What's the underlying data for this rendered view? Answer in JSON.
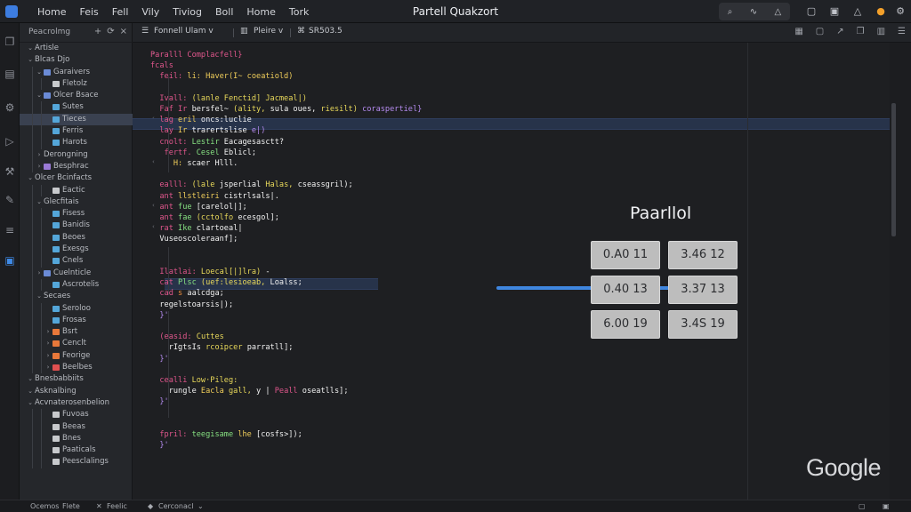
{
  "window": {
    "title": "Partell Quakzort",
    "menu": [
      "Home",
      "Feis",
      "Fell",
      "Vily",
      "Tiviog",
      "Boll",
      "Home",
      "Tork"
    ],
    "controls": [
      "search-icon",
      "pulse-icon",
      "bell-icon"
    ]
  },
  "sidebar": {
    "title": "Peacrolmg",
    "actions": [
      "+",
      "⟳",
      "×"
    ],
    "items": [
      {
        "label": "Artisle",
        "depth": 0,
        "chev": "v",
        "color": ""
      },
      {
        "label": "Blcas Djo",
        "depth": 0,
        "chev": "v",
        "color": ""
      },
      {
        "label": "Garaivers",
        "depth": 1,
        "chev": "v",
        "color": "#6b8bd6"
      },
      {
        "label": "Fletolz",
        "depth": 2,
        "chev": "",
        "color": "#c7c9cc"
      },
      {
        "label": "Olcer Bsace",
        "depth": 1,
        "chev": "v",
        "color": "#6b8bd6"
      },
      {
        "label": "Sutes",
        "depth": 2,
        "chev": "",
        "color": "#54a6d9"
      },
      {
        "label": "Tieces",
        "depth": 2,
        "chev": "",
        "color": "#54a6d9"
      },
      {
        "label": "Ferris",
        "depth": 2,
        "chev": "",
        "color": "#54a6d9"
      },
      {
        "label": "Harots",
        "depth": 2,
        "chev": "",
        "color": "#54a6d9"
      },
      {
        "label": "Derongning",
        "depth": 1,
        "chev": ">",
        "color": ""
      },
      {
        "label": "Besphrac",
        "depth": 1,
        "chev": ">",
        "color": "#9a7ad6"
      },
      {
        "label": "Olcer Bcinfacts",
        "depth": 0,
        "chev": "v",
        "color": ""
      },
      {
        "label": "Eactic",
        "depth": 2,
        "chev": "",
        "color": "#c7c9cc"
      },
      {
        "label": "Glecfitais",
        "depth": 1,
        "chev": "v",
        "color": ""
      },
      {
        "label": "Fisess",
        "depth": 2,
        "chev": "",
        "color": "#54a6d9"
      },
      {
        "label": "Banidis",
        "depth": 2,
        "chev": "",
        "color": "#54a6d9"
      },
      {
        "label": "Beoes",
        "depth": 2,
        "chev": "",
        "color": "#54a6d9"
      },
      {
        "label": "Exesgs",
        "depth": 2,
        "chev": "",
        "color": "#54a6d9"
      },
      {
        "label": "Cnels",
        "depth": 2,
        "chev": "",
        "color": "#54a6d9"
      },
      {
        "label": "Cuelnticle",
        "depth": 1,
        "chev": ">",
        "color": "#6b8bd6"
      },
      {
        "label": "Ascrotelis",
        "depth": 2,
        "chev": "",
        "color": "#54a6d9"
      },
      {
        "label": "Secaes",
        "depth": 1,
        "chev": "v",
        "color": ""
      },
      {
        "label": "Seroloo",
        "depth": 2,
        "chev": "",
        "color": "#54a6d9"
      },
      {
        "label": "Frosas",
        "depth": 2,
        "chev": "",
        "color": "#54a6d9"
      },
      {
        "label": "Bsrt",
        "depth": 2,
        "chev": ">",
        "color": "#e8783a"
      },
      {
        "label": "Cenclt",
        "depth": 2,
        "chev": ">",
        "color": "#e8783a"
      },
      {
        "label": "Feorige",
        "depth": 2,
        "chev": ">",
        "color": "#e8783a"
      },
      {
        "label": "Beelbes",
        "depth": 2,
        "chev": ">",
        "color": "#e05050"
      },
      {
        "label": "Bnesbabbiits",
        "depth": 0,
        "chev": "v",
        "color": ""
      },
      {
        "label": "Asknalbing",
        "depth": 0,
        "chev": "v",
        "color": ""
      },
      {
        "label": "Acvnaterosenbelion",
        "depth": 0,
        "chev": "v",
        "color": ""
      },
      {
        "label": "Fuvoas",
        "depth": 2,
        "chev": "",
        "color": "#c7c9cc"
      },
      {
        "label": "Beeas",
        "depth": 2,
        "chev": "",
        "color": "#c7c9cc"
      },
      {
        "label": "Bnes",
        "depth": 2,
        "chev": "",
        "color": "#c7c9cc"
      },
      {
        "label": "Paaticals",
        "depth": 2,
        "chev": "",
        "color": "#c7c9cc"
      },
      {
        "label": "Peesclalings",
        "depth": 2,
        "chev": "",
        "color": "#c7c9cc"
      }
    ],
    "selected_index": 6
  },
  "tabs": [
    {
      "label": "Fonnell Ulam",
      "suffix": "v"
    },
    {
      "label": "Pleire",
      "suffix": "v"
    },
    {
      "label": "SR503.5"
    }
  ],
  "editor": {
    "lines": [
      [
        [
          "Paralll Complacfell}",
          "kw"
        ]
      ],
      [
        [
          "fcals",
          "kw"
        ]
      ],
      [
        [
          "  feil: ",
          "kw"
        ],
        [
          "li: Haver(I~ coeatiold)",
          "ye"
        ]
      ],
      [],
      [
        [
          "  Ivall: ",
          "kw"
        ],
        [
          "(lanle Fenctid] Jacmeal|)",
          "fn"
        ]
      ],
      [
        [
          "  Faf Ir ",
          "kw"
        ],
        [
          "bersfel~ ",
          "st"
        ],
        [
          "(ality, ",
          "fn"
        ],
        [
          "sula oues, ",
          "st"
        ],
        [
          "riesilt) ",
          "fn"
        ],
        [
          "coraspertiel}",
          "pu"
        ]
      ],
      [
        [
          "  lag ",
          "kw"
        ],
        [
          "eril ",
          "ye"
        ],
        [
          "oncs:luclie",
          "st"
        ]
      ],
      [
        [
          "  lay ",
          "kw"
        ],
        [
          "Ir ",
          "ye"
        ],
        [
          "trarertslise ",
          "st"
        ],
        [
          "e|)",
          "pu"
        ]
      ],
      [
        [
          "  cnolt: ",
          "kw"
        ],
        [
          "Lestir ",
          "gr"
        ],
        [
          "Eacagesasctt?",
          "st"
        ]
      ],
      [
        [
          "   ",
          ""
        ],
        [
          "fertf. ",
          "kw"
        ],
        [
          "Cesel ",
          "gr"
        ],
        [
          "Eblicl;",
          "st"
        ]
      ],
      [
        [
          "     ",
          ""
        ],
        [
          "H: ",
          "ye"
        ],
        [
          "scaer ",
          "st"
        ],
        [
          "Hlll.",
          "st"
        ]
      ],
      [],
      [
        [
          "  ealll: ",
          "kw"
        ],
        [
          "(lale ",
          "fn"
        ],
        [
          "jsperlial ",
          "st"
        ],
        [
          "Halas, ",
          "fn"
        ],
        [
          "cseassgril);",
          "st"
        ]
      ],
      [
        [
          "  ant ",
          "kw"
        ],
        [
          "llstleiri ",
          "ye"
        ],
        [
          "cistrlsals|.",
          "st"
        ]
      ],
      [
        [
          "  ant ",
          "kw"
        ],
        [
          "fue ",
          "gr"
        ],
        [
          "[carelol|];",
          "st"
        ]
      ],
      [
        [
          "  ant ",
          "kw"
        ],
        [
          "fae ",
          "gr"
        ],
        [
          "(cctolfo ",
          "fn"
        ],
        [
          "ecesgol];",
          "st"
        ]
      ],
      [
        [
          "  rat ",
          "kw"
        ],
        [
          "Ike ",
          "gr"
        ],
        [
          "clartoeal|",
          "st"
        ]
      ],
      [
        [
          "  ",
          ""
        ],
        [
          "Vuseoscoleraanf];",
          "st"
        ]
      ],
      [],
      [],
      [
        [
          "  Ilatlai: ",
          "kw"
        ],
        [
          "Loecal[|]lra) ",
          "fn"
        ],
        [
          "-",
          "st"
        ]
      ],
      [
        [
          "  cat ",
          "kw"
        ],
        [
          "Plsc ",
          "gr"
        ],
        [
          "(uef:lesioeab, ",
          "fn"
        ],
        [
          "Loalss;",
          "st"
        ]
      ],
      [
        [
          "  cad ",
          "kw"
        ],
        [
          "s ",
          "or"
        ],
        [
          "aalcdga;",
          "st"
        ]
      ],
      [
        [
          "  ",
          ""
        ],
        [
          "regelstoarsis|);",
          "st"
        ]
      ],
      [
        [
          "  ",
          ""
        ],
        [
          "}'",
          "pu"
        ]
      ],
      [],
      [
        [
          "  ",
          ""
        ],
        [
          "(easid: ",
          "kw"
        ],
        [
          "Cuttes",
          "fn"
        ]
      ],
      [
        [
          "    ",
          ""
        ],
        [
          "rIgtsIs ",
          "st"
        ],
        [
          "rcoipcer ",
          "fn"
        ],
        [
          "parratll];",
          "st"
        ]
      ],
      [
        [
          "  ",
          ""
        ],
        [
          "}'",
          "pu"
        ]
      ],
      [],
      [
        [
          "  cealli ",
          "kw"
        ],
        [
          "Low·Pileg:",
          "fn"
        ]
      ],
      [
        [
          "    ",
          ""
        ],
        [
          "rungle ",
          "st"
        ],
        [
          "Eacla ",
          "ye"
        ],
        [
          "gall, ",
          "fn"
        ],
        [
          "y | ",
          "st"
        ],
        [
          "Peall ",
          "kw"
        ],
        [
          "oseatlls];",
          "st"
        ]
      ],
      [
        [
          "  ",
          ""
        ],
        [
          "}'",
          "pu"
        ]
      ],
      [],
      [],
      [
        [
          "  ",
          ""
        ],
        [
          "fpril: ",
          "kw"
        ],
        [
          "teegisame ",
          "gr"
        ],
        [
          "lhe ",
          "ye"
        ],
        [
          "[cosfs>]);",
          "st"
        ]
      ],
      [
        [
          "  ",
          ""
        ],
        [
          "}'",
          "pu"
        ]
      ]
    ]
  },
  "panel": {
    "title": "Paarllol",
    "cells": [
      [
        "0.A0  11",
        "3.46  12"
      ],
      [
        "0.40  13",
        "3.37  13"
      ],
      [
        "6.00  19",
        "3.4S  19"
      ]
    ]
  },
  "watermark": "Google",
  "status": {
    "left": "Ocemos",
    "item2": "Flete",
    "item3": "Feelic",
    "item4": "Cerconacl"
  },
  "colors": {
    "accent": "#3f86e0",
    "selection": "#27334a",
    "cell_bg": "#bdbdbd"
  }
}
